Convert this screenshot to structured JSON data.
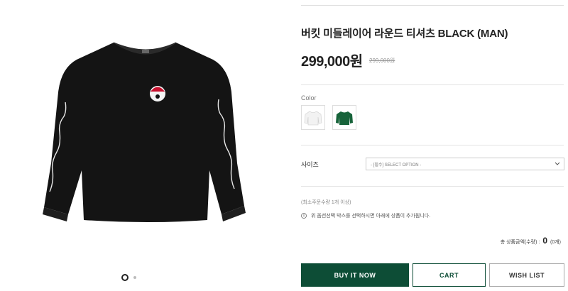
{
  "product": {
    "title": "버킷 미들레이어 라운드 티셔츠 BLACK (MAN)",
    "price": "299,000원",
    "original_price": "299,000원",
    "image_alt_icon": "black-long-sleeve-tshirt-image",
    "sleeve_script": "malbon"
  },
  "gallery": {
    "dots": [
      {
        "active": true
      },
      {
        "active": false
      }
    ]
  },
  "options": {
    "color_label": "Color",
    "colors": [
      {
        "name": "white",
        "hex": "#f2f2f2"
      },
      {
        "name": "green",
        "hex": "#17633a"
      }
    ],
    "size_label": "사이즈",
    "size_placeholder": "- [필수] SELECT OPTION -"
  },
  "notes": {
    "min_qty": "(최소주문수량 1개 이상)",
    "notice": "위 옵션선택 박스를 선택하시면 아래에 상품이 추가됩니다."
  },
  "total": {
    "label": "총 상품금액(수량) :",
    "value": "0",
    "count": "(0개)"
  },
  "buttons": {
    "buy": "BUY IT NOW",
    "cart": "CART",
    "wishlist": "WISH LIST"
  },
  "colors": {
    "brand": "#0d4d36",
    "shirt": "#141414"
  }
}
